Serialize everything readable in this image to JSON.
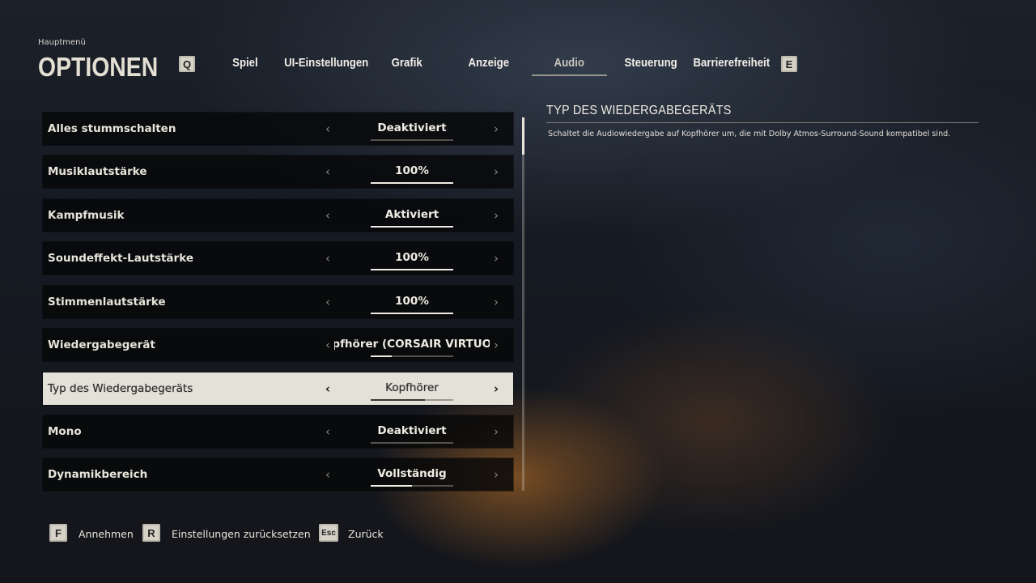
{
  "header": {
    "breadcrumb": "Hauptmenü",
    "title": "OPTIONEN",
    "prev_key": "Q",
    "next_key": "E"
  },
  "tabs": [
    {
      "label": "Spiel",
      "active": false
    },
    {
      "label": "UI-Einstellungen",
      "active": false
    },
    {
      "label": "Grafik",
      "active": false
    },
    {
      "label": "Anzeige",
      "active": false
    },
    {
      "label": "Audio",
      "active": true
    },
    {
      "label": "Steuerung",
      "active": false
    },
    {
      "label": "Barrierefreiheit",
      "active": false
    }
  ],
  "settings": [
    {
      "label": "Alles stummschalten",
      "value": "Deaktiviert",
      "level": 0.0
    },
    {
      "label": "Musiklautstärke",
      "value": "100%",
      "level": 1.0
    },
    {
      "label": "Kampfmusik",
      "value": "Aktiviert",
      "level": 1.0
    },
    {
      "label": "Soundeffekt-Lautstärke",
      "value": "100%",
      "level": 1.0
    },
    {
      "label": "Stimmenlautstärke",
      "value": "100%",
      "level": 1.0
    },
    {
      "label": "Wiedergabegerät",
      "value": "opfhörer (CORSAIR VIRTUOS",
      "level": 0.25
    },
    {
      "label": "Typ des Wiedergabegeräts",
      "value": "Kopfhörer",
      "level": 0.66,
      "selected": true
    },
    {
      "label": "Mono",
      "value": "Deaktiviert",
      "level": 0.0
    },
    {
      "label": "Dynamikbereich",
      "value": "Vollständig",
      "level": 0.5
    }
  ],
  "scroll": {
    "position": 0.0,
    "visible_fraction": 0.1
  },
  "description": {
    "title": "TYP DES WIEDERGABEGERÄTS",
    "text": "Schaltet die Audiowiedergabe auf Kopfhörer um, die mit Dolby Atmos-Surround-Sound kompatibel sind."
  },
  "footer": [
    {
      "key": "F",
      "label": "Annehmen"
    },
    {
      "key": "R",
      "label": "Einstellungen zurücksetzen"
    },
    {
      "key": "Esc",
      "label": "Zurück"
    }
  ],
  "icons": {
    "arrow_left": "‹",
    "arrow_right": "›"
  }
}
